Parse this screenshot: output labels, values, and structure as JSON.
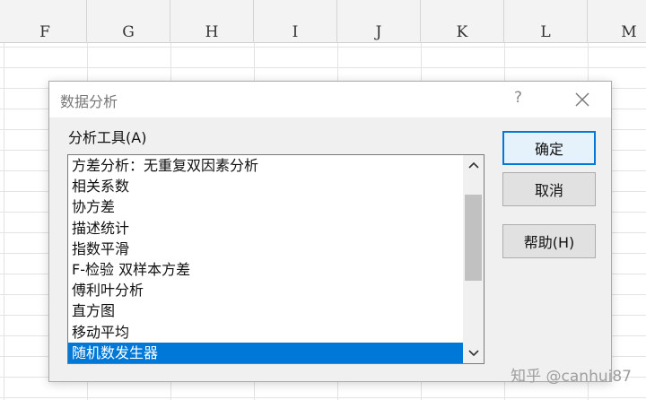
{
  "sheet": {
    "columns": [
      "F",
      "G",
      "H",
      "I",
      "J",
      "K",
      "L",
      "M"
    ]
  },
  "dialog": {
    "title": "数据分析",
    "help_glyph": "?",
    "tools_label": "分析工具(A)",
    "tools": [
      "方差分析：无重复双因素分析",
      "相关系数",
      "协方差",
      "描述统计",
      "指数平滑",
      "F-检验 双样本方差",
      "傅利叶分析",
      "直方图",
      "移动平均",
      "随机数发生器"
    ],
    "selected_index": 9,
    "buttons": {
      "ok": "确定",
      "cancel": "取消",
      "help": "帮助(H)"
    }
  },
  "watermark": "知乎 @canhui87",
  "colors": {
    "selection": "#0078d7",
    "dialog_body": "#f0f0f0",
    "header_bar": "#f3f3f3"
  }
}
